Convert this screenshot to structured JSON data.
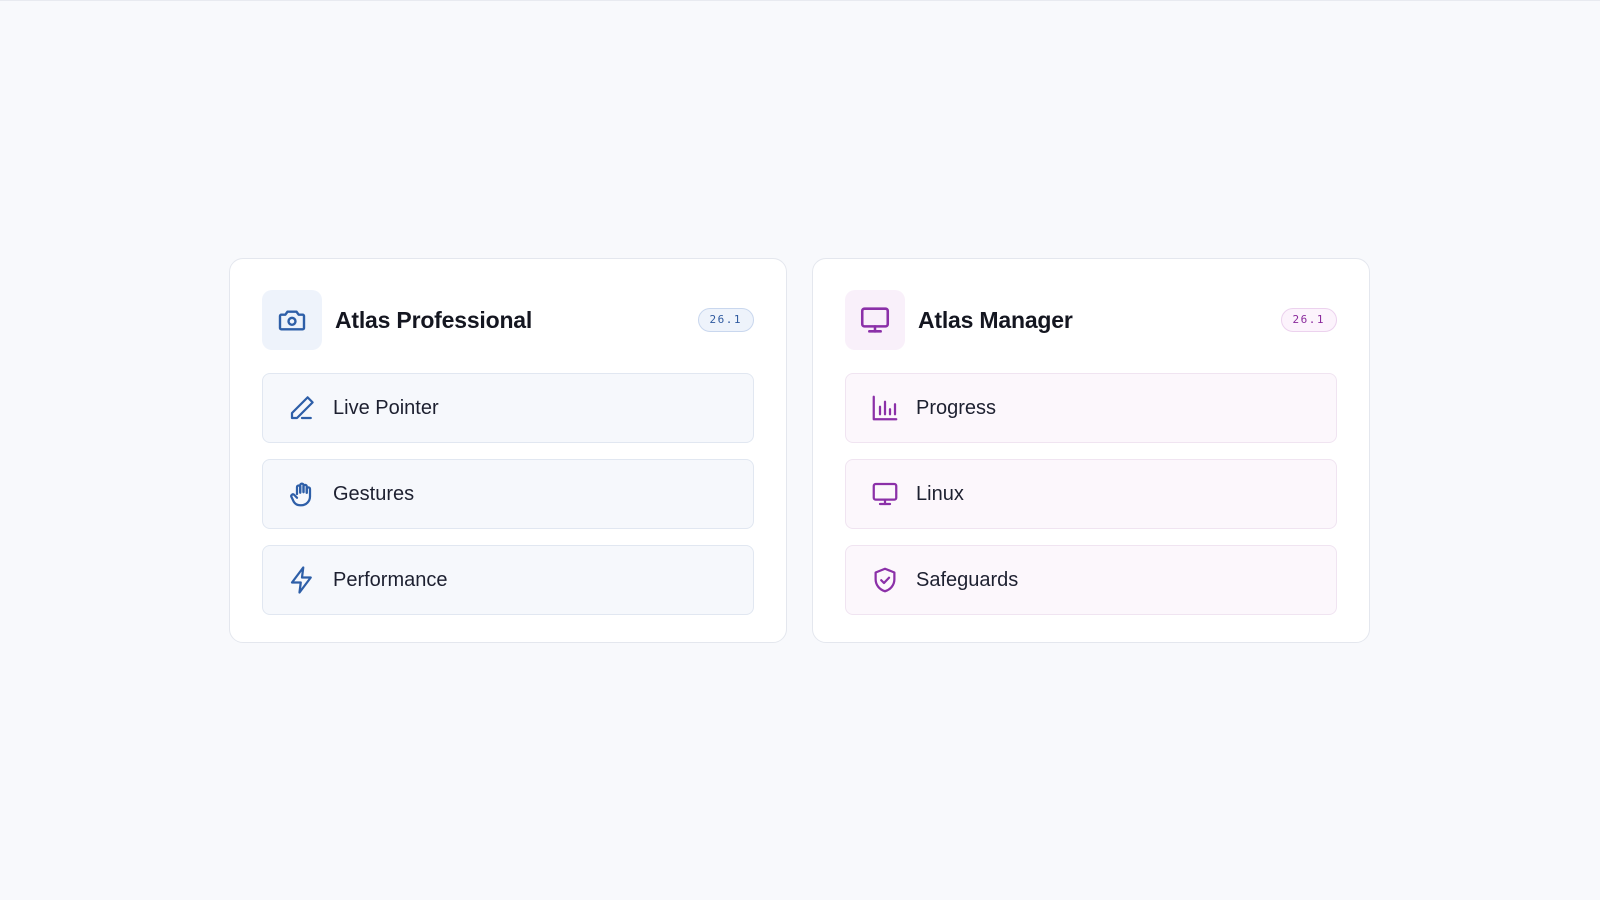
{
  "colors": {
    "blue_accent": "#2e5fa8",
    "purple_accent": "#8b30a8",
    "background": "#f8f9fc"
  },
  "cards": [
    {
      "title": "Atlas Professional",
      "icon": "camera-icon",
      "version": "26.1",
      "features": [
        {
          "label": "Live Pointer",
          "icon": "pen-icon"
        },
        {
          "label": "Gestures",
          "icon": "hand-icon"
        },
        {
          "label": "Performance",
          "icon": "lightning-icon"
        }
      ]
    },
    {
      "title": "Atlas Manager",
      "icon": "monitor-icon",
      "version": "26.1",
      "features": [
        {
          "label": "Progress",
          "icon": "bar-chart-icon"
        },
        {
          "label": "Linux",
          "icon": "monitor-icon"
        },
        {
          "label": "Safeguards",
          "icon": "shield-check-icon"
        }
      ]
    }
  ]
}
